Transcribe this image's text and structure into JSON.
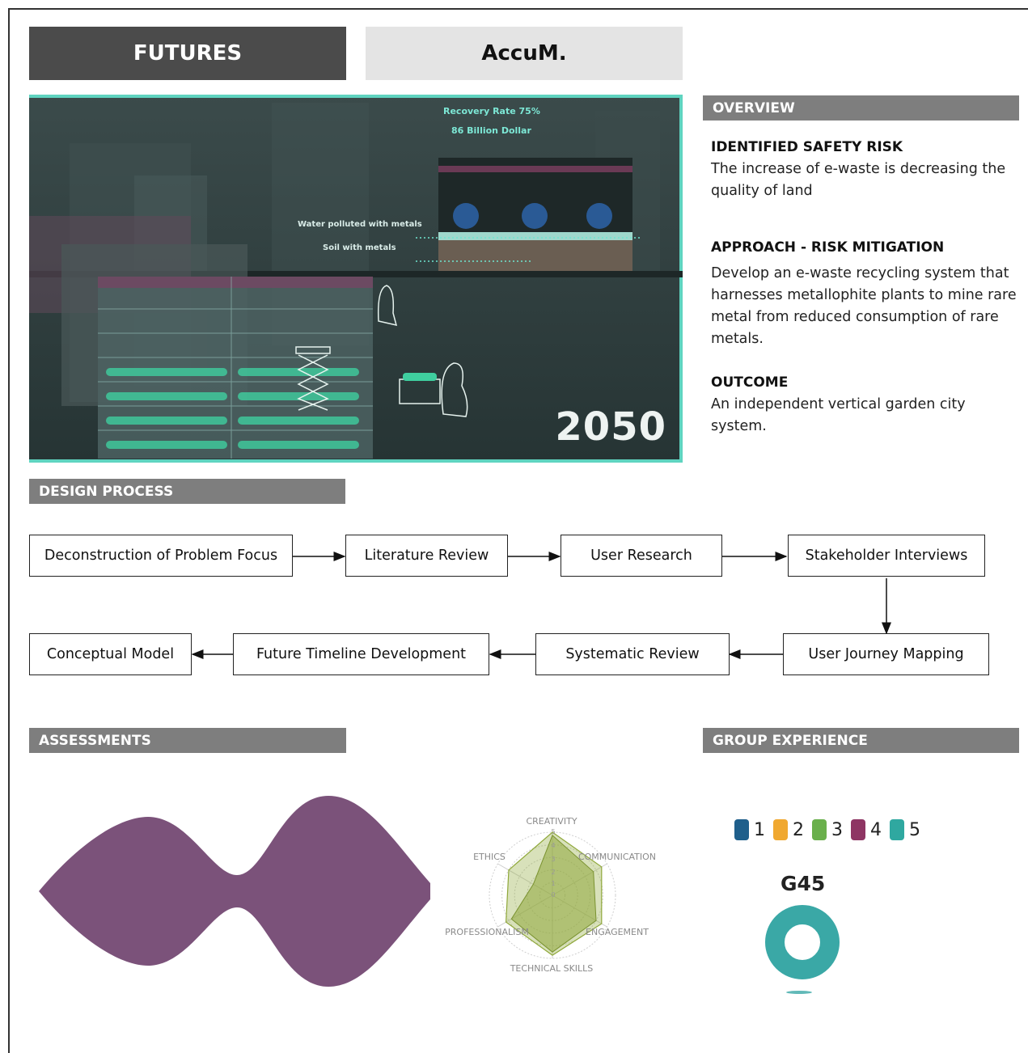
{
  "tabs": {
    "primary": "FUTURES",
    "secondary": "AccuM."
  },
  "hero": {
    "recovery_rate": "Recovery Rate 75%",
    "value": "86 Billion Dollar",
    "water_label": "Water polluted with metals",
    "soil_label": "Soil with metals",
    "year": "2050"
  },
  "overview": {
    "title": "OVERVIEW",
    "risk_heading": "IDENTIFIED SAFETY RISK",
    "risk_text": "The increase of e-waste is decreasing the quality of land",
    "approach_heading": "APPROACH - RISK MITIGATION",
    "approach_text": "Develop an e-waste recycling system that harnesses metallophite plants to mine rare metal from reduced consumption of rare metals.",
    "outcome_heading": "OUTCOME",
    "outcome_text": "An independent vertical garden city system."
  },
  "design_process": {
    "title": "DESIGN PROCESS",
    "steps": [
      "Deconstruction of Problem Focus",
      "Literature Review",
      "User Research",
      "Stakeholder Interviews",
      "User Journey Mapping",
      "Systematic Review",
      "Future Timeline Development",
      "Conceptual Model"
    ]
  },
  "assessments": {
    "title": "ASSESSMENTS",
    "wave_color": "#7b527a",
    "radar_color": "#8fa83a",
    "radar_axes": [
      "CREATIVITY",
      "COMMUNICATION",
      "ENGAGEMENT",
      "TECHNICAL SKILLS",
      "PROFESSIONALISM",
      "ETHICS"
    ],
    "radar_ticks": [
      "5",
      "4",
      "3",
      "2",
      "1",
      "0"
    ]
  },
  "group_experience": {
    "title": "GROUP EXPERIENCE",
    "legend": [
      {
        "label": "1",
        "color": "#1f5f8b"
      },
      {
        "label": "2",
        "color": "#f0a830"
      },
      {
        "label": "3",
        "color": "#6ab04c"
      },
      {
        "label": "4",
        "color": "#8e3563"
      },
      {
        "label": "5",
        "color": "#2fa8a0"
      }
    ],
    "group": "G45",
    "ring_color": "#3aa8a6"
  }
}
